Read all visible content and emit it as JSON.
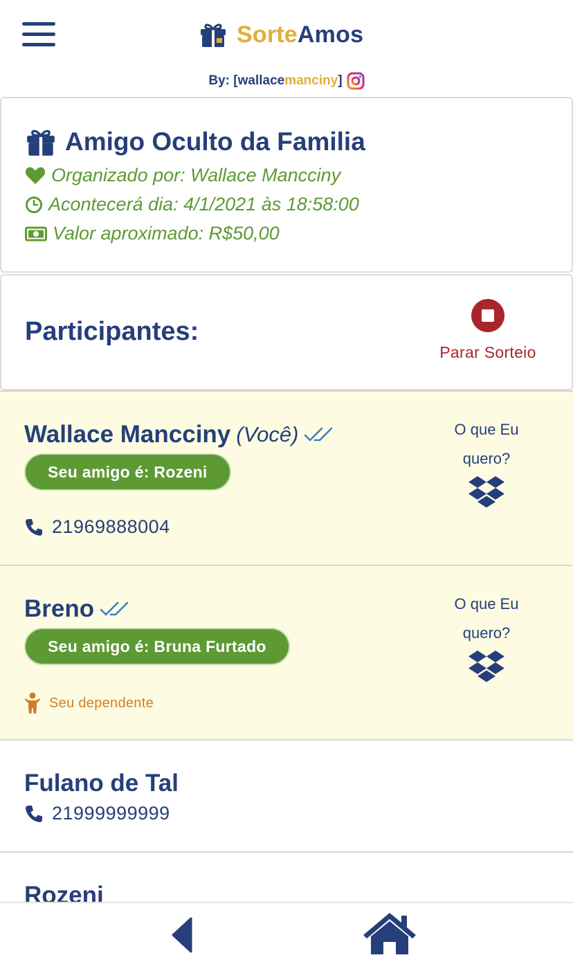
{
  "header": {
    "brand_part1": "Sorte",
    "brand_part2": "Amos",
    "by_prefix": "By: [",
    "by_handle_part1": "wallace",
    "by_handle_part2": "manciny",
    "by_suffix": "]"
  },
  "event": {
    "title": "Amigo Oculto da Familia",
    "organizer": "Organizado por: Wallace Mancciny",
    "date": "Acontecerá dia: 4/1/2021 às 18:58:00",
    "value": "Valor aproximado: R$50,00"
  },
  "participants_section": {
    "title": "Participantes:",
    "stop_label": "Parar Sorteio"
  },
  "participants": [
    {
      "name": "Wallace Mancciny",
      "you_label": "(Você)",
      "friend": "Seu amigo é: Rozeni",
      "phone": "21969888004",
      "wishlist_label": "O que Eu quero?"
    },
    {
      "name": "Breno",
      "friend": "Seu amigo é: Bruna Furtado",
      "dependent_label": "Seu dependente",
      "wishlist_label": "O que Eu quero?"
    },
    {
      "name": "Fulano de Tal",
      "phone": "21999999999"
    },
    {
      "name": "Rozeni"
    }
  ],
  "colors": {
    "navy": "#253f7a",
    "gold": "#e2ad3a",
    "green": "#5d9a33",
    "red": "#a8262b",
    "highlight": "#fdfce2",
    "orange": "#d07e2a"
  },
  "icons": {
    "menu": "hamburger-menu-icon",
    "brand": "gift-icon",
    "instagram": "instagram-icon",
    "organizer": "heart-icon",
    "date": "clock-icon",
    "value": "money-bill-icon",
    "stop": "stop-icon",
    "double_check": "double-check-icon",
    "phone": "phone-icon",
    "wishlist": "dropbox-icon",
    "dependent": "child-icon",
    "back": "back-arrow-icon",
    "home": "home-icon"
  }
}
